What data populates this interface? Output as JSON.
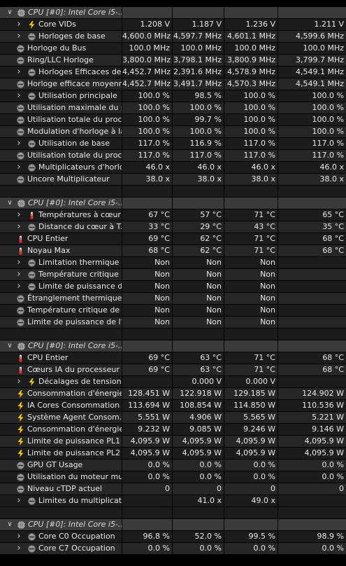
{
  "sections": [
    {
      "header": "CPU [#0]: Intel Core i5-...",
      "rows": [
        {
          "label": "Core VIDs",
          "icon": "bolt",
          "expandable": true,
          "indent": 1,
          "values": [
            "1.208 V",
            "1.187 V",
            "1.236 V",
            "1.211 V"
          ]
        },
        {
          "label": "Horloges de base",
          "icon": "clock",
          "expandable": true,
          "indent": 1,
          "values": [
            "4,600.0 MHz",
            "4,597.7 MHz",
            "4,601.1 MHz",
            "4,599.6 MHz"
          ]
        },
        {
          "label": "Horloge du Bus",
          "icon": "clock",
          "expandable": false,
          "indent": 0,
          "values": [
            "100.0 MHz",
            "100.0 MHz",
            "100.0 MHz",
            "100.0 MHz"
          ]
        },
        {
          "label": "Ring/LLC Horloge",
          "icon": "clock",
          "expandable": false,
          "indent": 0,
          "values": [
            "3,800.0 MHz",
            "3,798.1 MHz",
            "3,800.9 MHz",
            "3,799.7 MHz"
          ]
        },
        {
          "label": "Horloges Efficaces de...",
          "icon": "clock",
          "expandable": true,
          "indent": 1,
          "values": [
            "4,452.7 MHz",
            "2,391.6 MHz",
            "4,578.9 MHz",
            "4,549.1 MHz"
          ]
        },
        {
          "label": "Horloge efficace moyenne",
          "icon": "clock",
          "expandable": false,
          "indent": 0,
          "values": [
            "4,452.7 MHz",
            "3,491.7 MHz",
            "4,570.3 MHz",
            "4,549.1 MHz"
          ]
        },
        {
          "label": "Utilisation principale",
          "icon": "clock",
          "expandable": true,
          "indent": 1,
          "values": [
            "100.0 %",
            "98.5 %",
            "100.0 %",
            "100.0 %"
          ]
        },
        {
          "label": "Utilisation maximale du p...",
          "icon": "clock",
          "expandable": false,
          "indent": 0,
          "values": [
            "100.0 %",
            "100.0 %",
            "100.0 %",
            "100.0 %"
          ]
        },
        {
          "label": "Utilisation totale du proc...",
          "icon": "clock",
          "expandable": false,
          "indent": 0,
          "values": [
            "100.0 %",
            "99.7 %",
            "100.0 %",
            "100.0 %"
          ]
        },
        {
          "label": "Modulation d'horloge à la...",
          "icon": "clock",
          "expandable": false,
          "indent": 0,
          "values": [
            "100.0 %",
            "100.0 %",
            "100.0 %",
            "100.0 %"
          ]
        },
        {
          "label": "Utilisation de base",
          "icon": "clock",
          "expandable": true,
          "indent": 1,
          "values": [
            "117.0 %",
            "116.9 %",
            "117.0 %",
            "117.0 %"
          ]
        },
        {
          "label": "Utilisation totale du proc...",
          "icon": "clock",
          "expandable": false,
          "indent": 0,
          "values": [
            "117.0 %",
            "117.0 %",
            "117.0 %",
            "117.0 %"
          ]
        },
        {
          "label": "Multiplicateurs d'horlo...",
          "icon": "clock",
          "expandable": true,
          "indent": 1,
          "values": [
            "46.0 x",
            "46.0 x",
            "46.0 x",
            "46.0 x"
          ]
        },
        {
          "label": "Uncore Multiplicateur",
          "icon": "clock",
          "expandable": false,
          "indent": 0,
          "values": [
            "38.0 x",
            "38.0 x",
            "38.0 x",
            "38.0 x"
          ]
        }
      ]
    },
    {
      "header": "CPU [#0]: Intel Core i5-...",
      "rows": [
        {
          "label": "Températures à cœur",
          "icon": "therm",
          "expandable": true,
          "indent": 1,
          "values": [
            "67 °C",
            "57 °C",
            "71 °C",
            "65 °C"
          ]
        },
        {
          "label": "Distance du cœur à T...",
          "icon": "clock",
          "expandable": true,
          "indent": 1,
          "values": [
            "33 °C",
            "29 °C",
            "43 °C",
            "35 °C"
          ]
        },
        {
          "label": "CPU Entier",
          "icon": "therm",
          "expandable": false,
          "indent": 0,
          "values": [
            "69 °C",
            "62 °C",
            "71 °C",
            "68 °C"
          ]
        },
        {
          "label": "Noyau Max",
          "icon": "therm",
          "expandable": false,
          "indent": 0,
          "values": [
            "68 °C",
            "62 °C",
            "71 °C",
            "68 °C"
          ]
        },
        {
          "label": "Limitation thermique ...",
          "icon": "clock",
          "expandable": true,
          "indent": 1,
          "values": [
            "Non",
            "Non",
            "Non",
            ""
          ]
        },
        {
          "label": "Température critique ...",
          "icon": "clock",
          "expandable": true,
          "indent": 1,
          "values": [
            "Non",
            "Non",
            "Non",
            ""
          ]
        },
        {
          "label": "Limite de puissance d...",
          "icon": "clock",
          "expandable": true,
          "indent": 1,
          "values": [
            "Non",
            "Non",
            "Non",
            ""
          ]
        },
        {
          "label": "Étranglement thermique ...",
          "icon": "clock",
          "expandable": false,
          "indent": 0,
          "values": [
            "Non",
            "Non",
            "Non",
            ""
          ]
        },
        {
          "label": "Température critique de ...",
          "icon": "clock",
          "expandable": false,
          "indent": 0,
          "values": [
            "Non",
            "Non",
            "Non",
            ""
          ]
        },
        {
          "label": "Limite de puissance de l'...",
          "icon": "clock",
          "expandable": false,
          "indent": 0,
          "values": [
            "Non",
            "Non",
            "Non",
            ""
          ]
        }
      ]
    },
    {
      "header": "CPU [#0]: Intel Core i5-...",
      "rows": [
        {
          "label": "CPU Entier",
          "icon": "therm",
          "expandable": false,
          "indent": 0,
          "values": [
            "69 °C",
            "63 °C",
            "71 °C",
            "68 °C"
          ]
        },
        {
          "label": "Cœurs IA du processeur",
          "icon": "therm",
          "expandable": false,
          "indent": 0,
          "values": [
            "69 °C",
            "63 °C",
            "71 °C",
            "68 °C"
          ]
        },
        {
          "label": "Décalages de tension",
          "icon": "bolt",
          "expandable": true,
          "indent": 1,
          "values": [
            "",
            "0.000 V",
            "0.000 V",
            ""
          ]
        },
        {
          "label": "Consommation d'énergie...",
          "icon": "bolt",
          "expandable": false,
          "indent": 0,
          "values": [
            "128.451 W",
            "122.918 W",
            "129.185 W",
            "124.902 W"
          ]
        },
        {
          "label": "IA Cores Consommation ...",
          "icon": "bolt",
          "expandable": false,
          "indent": 0,
          "values": [
            "113.694 W",
            "108.854 W",
            "114.850 W",
            "110.536 W"
          ]
        },
        {
          "label": "Système Agent Consom...",
          "icon": "bolt",
          "expandable": false,
          "indent": 0,
          "values": [
            "5.551 W",
            "4.906 W",
            "5.565 W",
            "5.221 W"
          ]
        },
        {
          "label": "Consommation d'énergie...",
          "icon": "bolt",
          "expandable": false,
          "indent": 0,
          "values": [
            "9.232 W",
            "9.085 W",
            "9.246 W",
            "9.146 W"
          ]
        },
        {
          "label": "Limite de puissance PL1",
          "icon": "bolt",
          "expandable": false,
          "indent": 0,
          "values": [
            "4,095.9 W",
            "4,095.9 W",
            "4,095.9 W",
            "4,095.9 W"
          ]
        },
        {
          "label": "Limite de puissance PL2",
          "icon": "bolt",
          "expandable": false,
          "indent": 0,
          "values": [
            "4,095.9 W",
            "4,095.9 W",
            "4,095.9 W",
            "4,095.9 W"
          ]
        },
        {
          "label": "GPU GT Usage",
          "icon": "clock",
          "expandable": false,
          "indent": 0,
          "values": [
            "0.0 %",
            "0.0 %",
            "0.0 %",
            "0.0 %"
          ]
        },
        {
          "label": "Utilisation du moteur mul...",
          "icon": "clock",
          "expandable": false,
          "indent": 0,
          "values": [
            "0.0 %",
            "0.0 %",
            "0.0 %",
            "0.0 %"
          ]
        },
        {
          "label": "Niveau cTDP actuel",
          "icon": "clock",
          "expandable": false,
          "indent": 0,
          "values": [
            "0",
            "0",
            "0",
            "0"
          ]
        },
        {
          "label": "Limites du multiplicate...",
          "icon": "clock",
          "expandable": true,
          "indent": 1,
          "values": [
            "",
            "41.0 x",
            "49.0 x",
            ""
          ]
        }
      ]
    },
    {
      "header": "CPU [#0]: Intel Core i5-...",
      "rows": [
        {
          "label": "Core C0 Occupation",
          "icon": "clock",
          "expandable": true,
          "indent": 1,
          "values": [
            "96.8 %",
            "52.0 %",
            "99.5 %",
            "98.9 %"
          ]
        },
        {
          "label": "Core C7 Occupation",
          "icon": "clock",
          "expandable": true,
          "indent": 1,
          "values": [
            "0.0 %",
            "0.0 %",
            "0.0 %",
            "0.0 %"
          ]
        }
      ]
    }
  ]
}
